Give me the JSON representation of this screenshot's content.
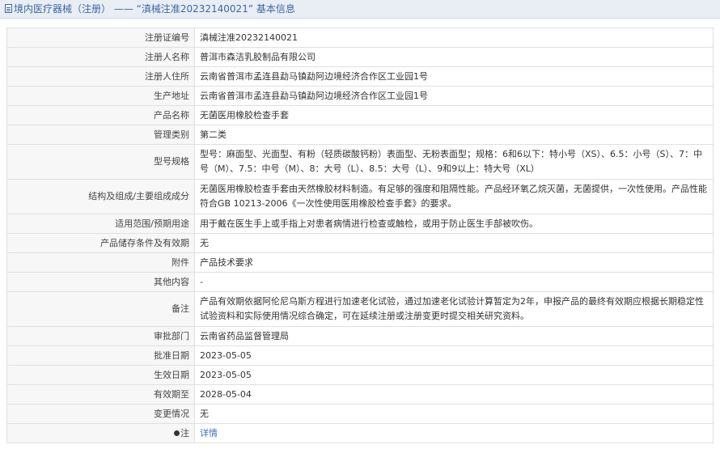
{
  "header": {
    "text": "境内医疗器械（注册） —— “滇械注准20232140021” 基本信息"
  },
  "rows": [
    {
      "label": "注册证编号",
      "value": "滇械注准20232140021"
    },
    {
      "label": "注册人名称",
      "value": "普洱市森洁乳胶制品有限公司"
    },
    {
      "label": "注册人住所",
      "value": "云南省普洱市孟连县勐马镇勐阿边境经济合作区工业园1号"
    },
    {
      "label": "生产地址",
      "value": "云南省普洱市孟连县勐马镇勐阿边境经济合作区工业园1号"
    },
    {
      "label": "产品名称",
      "value": "无菌医用橡胶检查手套"
    },
    {
      "label": "管理类别",
      "value": "第二类"
    },
    {
      "label": "型号规格",
      "value": "型号：麻面型、光面型、有粉（轻质碳酸钙粉）表面型、无粉表面型；规格：6和6以下：特小号（XS）、6.5：小号（S）、7：中号（M）、7.5：中号（M）、8：大号（L）、8.5：大号（L）、9和9以上：特大号（XL）"
    },
    {
      "label": "结构及组成/主要组成成分",
      "value": "无菌医用橡胶检查手套由天然橡胶材料制造。有足够的强度和阻隔性能。产品经环氧乙烷灭菌，无菌提供，一次性使用。产品性能符合GB 10213-2006《一次性使用医用橡胶检查手套》的要求。"
    },
    {
      "label": "适用范围/预期用途",
      "value": "用于戴在医生手上或手指上对患者病情进行检查或触检，或用于防止医生手部被吹伤。"
    },
    {
      "label": "产品储存条件及有效期",
      "value": "无"
    },
    {
      "label": "附件",
      "value": "产品技术要求"
    },
    {
      "label": "其他内容",
      "value": "-"
    },
    {
      "label": "备注",
      "value": "产品有效期依据阿伦尼乌斯方程进行加速老化试验，通过加速老化试验计算暂定为2年，申报产品的最终有效期应根据长期稳定性试验资料和实际使用情况综合确定，可在延续注册或注册变更时提交相关研究资料。"
    },
    {
      "label": "审批部门",
      "value": "云南省药品监督管理局"
    },
    {
      "label": "批准日期",
      "value": "2023-05-05"
    },
    {
      "label": "生效日期",
      "value": "2023-05-05"
    },
    {
      "label": "有效期至",
      "value": "2028-05-04"
    },
    {
      "label": "变更情况",
      "value": "无"
    },
    {
      "label": "注",
      "value": "详情"
    }
  ],
  "icons": {
    "header_icon": "document-icon",
    "note_icon": "lightbulb-icon"
  }
}
